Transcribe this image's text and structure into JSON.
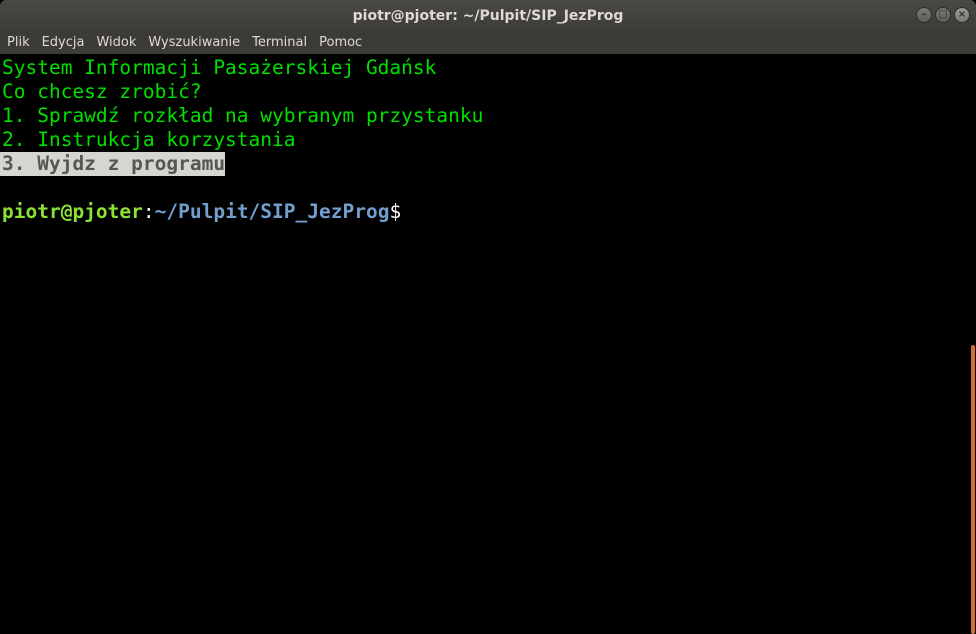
{
  "window": {
    "title": "piotr@pjoter: ~/Pulpit/SIP_JezProg",
    "controls": {
      "minimize": "–",
      "maximize": "□",
      "close": "×"
    }
  },
  "menubar": {
    "items": [
      "Plik",
      "Edycja",
      "Widok",
      "Wyszukiwanie",
      "Terminal",
      "Pomoc"
    ]
  },
  "terminal": {
    "lines": [
      "System Informacji Pasażerskiej Gdańsk",
      "Co chcesz zrobić?",
      "1. Sprawdź rozkład na wybranym przystanku",
      "2. Instrukcja korzystania",
      "3. Wyjdz z programu"
    ],
    "prompt": {
      "user_host": "piotr@pjoter",
      "colon": ":",
      "path": "~/Pulpit/SIP_JezProg",
      "dollar": "$"
    }
  },
  "colors": {
    "output_text": "#00e000",
    "prompt_user": "#8ae234",
    "prompt_path": "#729fcf",
    "highlight_bg": "#d3d7cf",
    "scroll_thumb": "#d46c30"
  }
}
